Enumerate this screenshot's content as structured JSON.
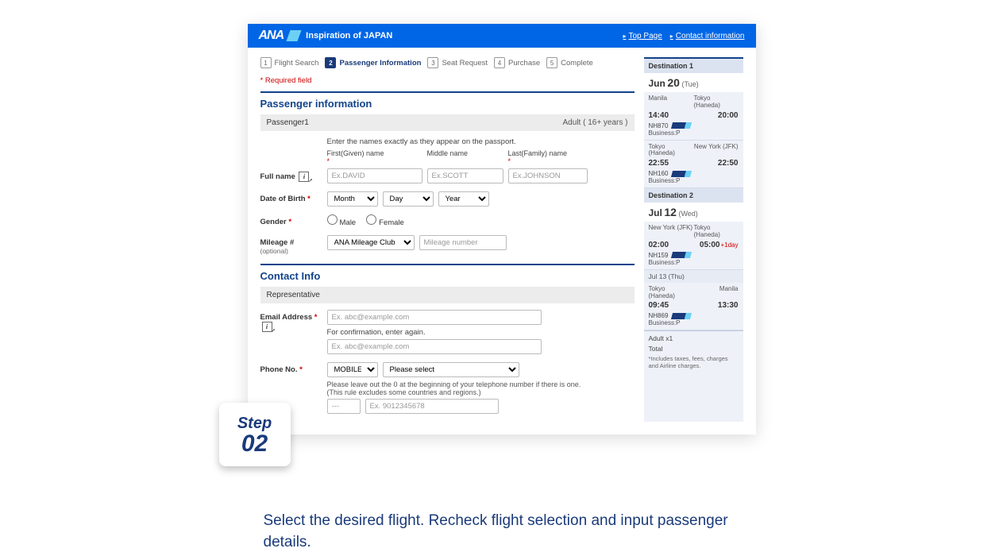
{
  "header": {
    "logo": "ANA",
    "tagline": "Inspiration of JAPAN",
    "links": {
      "top": "Top Page",
      "contact": "Contact information"
    }
  },
  "steps": [
    {
      "num": "1",
      "label": "Flight Search"
    },
    {
      "num": "2",
      "label": "Passenger Information"
    },
    {
      "num": "3",
      "label": "Seat Request"
    },
    {
      "num": "4",
      "label": "Purchase"
    },
    {
      "num": "5",
      "label": "Complete"
    }
  ],
  "required_note": "Required field",
  "passenger_title": "Passenger information",
  "passenger_bar": {
    "label": "Passenger1",
    "type": "Adult ( 16+ years )"
  },
  "name_hint": "Enter the names exactly as they appear on the passport.",
  "name_headers": {
    "first": "First(Given) name",
    "middle": "Middle name",
    "last": "Last(Family) name"
  },
  "labels": {
    "full_name": "Full name",
    "dob": "Date of Birth",
    "gender": "Gender",
    "mileage": "Mileage #",
    "mileage_opt": "(optional)",
    "email": "Email Address",
    "phone": "Phone No."
  },
  "placeholders": {
    "first": "Ex.DAVID",
    "middle": "Ex.SCOTT",
    "last": "Ex.JOHNSON",
    "mileage_num": "Mileage number",
    "email": "Ex. abc@example.com",
    "phone_cc": "---",
    "phone_num": "Ex. 9012345678"
  },
  "dob_options": {
    "month": "Month",
    "day": "Day",
    "year": "Year"
  },
  "gender": {
    "male": "Male",
    "female": "Female"
  },
  "mileage_program": "ANA Mileage Club",
  "contact_title": "Contact Info",
  "representative": "Representative",
  "email_confirm": "For confirmation, enter again.",
  "phone_type": "MOBILE",
  "phone_country": "Please select",
  "phone_note": "Please leave out the 0 at the beginning of your telephone number if there is one. (This rule excludes some countries and regions.)",
  "sidebar": {
    "dest1_label": "Destination 1",
    "dest1_date": {
      "month": "Jun",
      "day": "20",
      "dow": "(Tue)"
    },
    "seg1": {
      "from_city": "Manila",
      "to_city": "Tokyo (Haneda)",
      "from_time": "14:40",
      "to_time": "20:00",
      "code": "NH870",
      "cabin": "Business:P"
    },
    "seg2": {
      "from_city": "Tokyo (Haneda)",
      "to_city": "New York (JFK)",
      "from_time": "22:55",
      "to_time": "22:50",
      "code": "NH160",
      "cabin": "Business:P"
    },
    "dest2_label": "Destination 2",
    "dest2_date": {
      "month": "Jul",
      "day": "12",
      "dow": "(Wed)"
    },
    "seg3": {
      "from_city": "New York (JFK)",
      "to_city": "Tokyo (Haneda)",
      "from_time": "02:00",
      "to_time": "05:00",
      "plus": "+1day",
      "code": "NH159",
      "cabin": "Business:P"
    },
    "mid_date": "Jul 13   (Thu)",
    "seg4": {
      "from_city": "Tokyo (Haneda)",
      "to_city": "Manila",
      "from_time": "09:45",
      "to_time": "13:30",
      "code": "NH869",
      "cabin": "Business:P"
    },
    "adult": "Adult x1",
    "total": "Total",
    "fine": "*Includes taxes, fees, charges and Airline charges."
  },
  "step_badge": {
    "line1": "Step",
    "line2": "02"
  },
  "caption": "Select the desired flight. Recheck flight selection and input passenger details."
}
